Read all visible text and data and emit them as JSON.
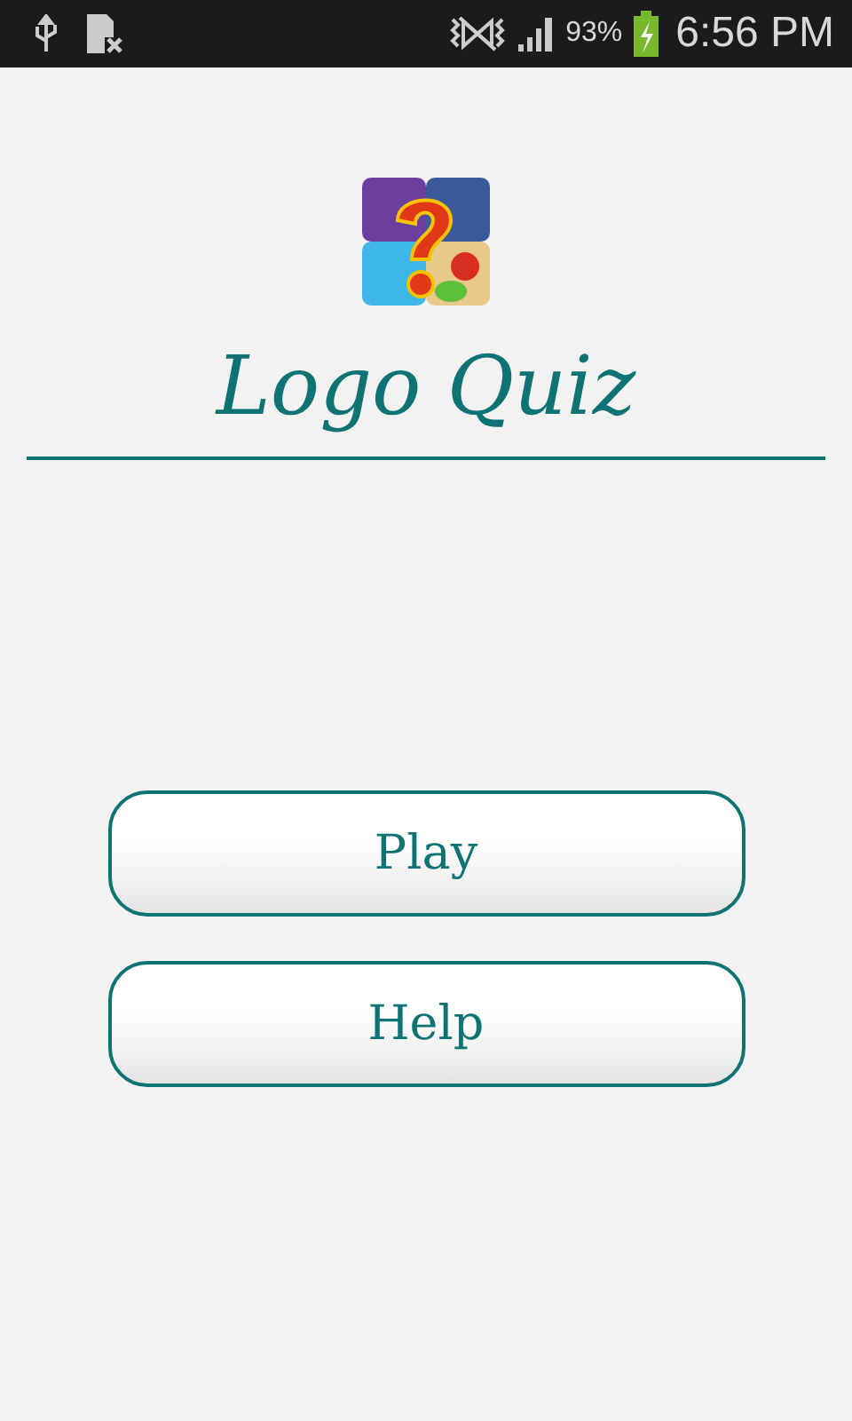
{
  "status_bar": {
    "battery_percent": "93%",
    "time": "6:56 PM"
  },
  "app": {
    "title": "Logo Quiz"
  },
  "buttons": [
    {
      "label": "Play"
    },
    {
      "label": "Help"
    }
  ]
}
